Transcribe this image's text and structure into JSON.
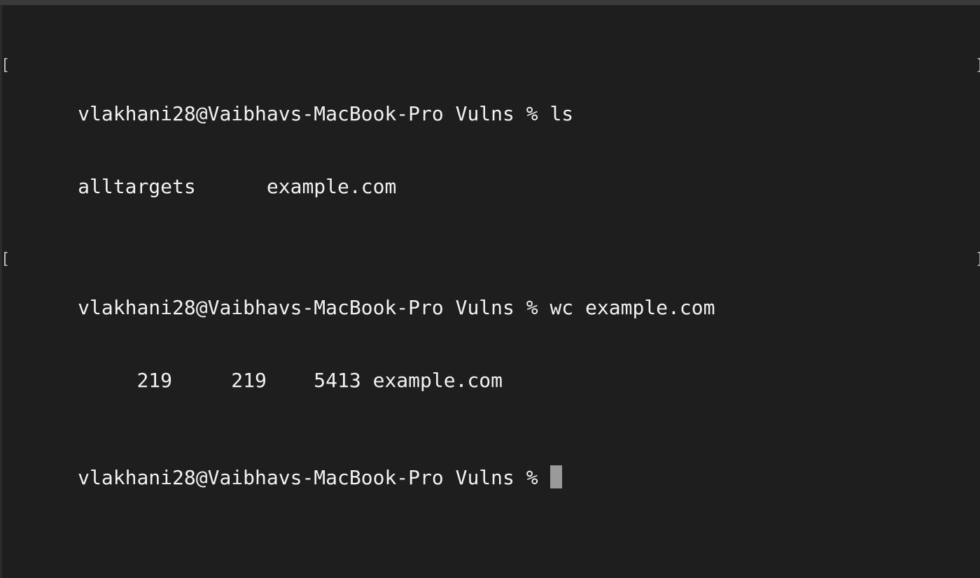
{
  "terminal": {
    "lines": [
      {
        "prompt": "vlakhani28@Vaibhavs-MacBook-Pro Vulns % ",
        "command": "ls",
        "marker_left": "[",
        "marker_right": "]"
      },
      {
        "output": "alltargets      example.com"
      },
      {
        "prompt": "vlakhani28@Vaibhavs-MacBook-Pro Vulns % ",
        "command": "wc example.com",
        "marker_left": "[",
        "marker_right": "]"
      },
      {
        "output": "     219     219    5413 example.com"
      },
      {
        "prompt": "vlakhani28@Vaibhavs-MacBook-Pro Vulns % ",
        "command": ""
      }
    ],
    "colors": {
      "background": "#1e1e1e",
      "text": "#f2f2f2",
      "cursor": "#9a9a9a"
    }
  }
}
